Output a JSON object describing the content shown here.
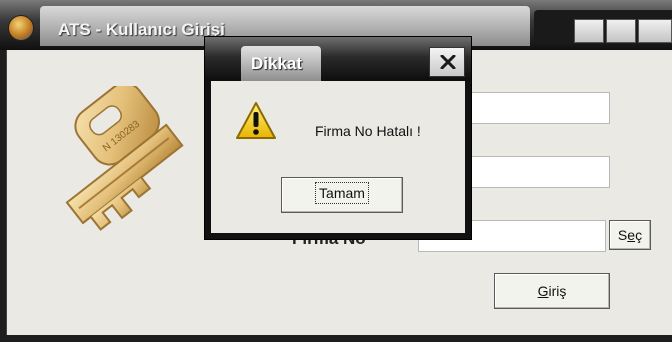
{
  "main_window": {
    "title": "ATS - Kullanıcı Girişi",
    "fields": {
      "firma_no_label": "Firma No",
      "username_value": "",
      "password_value": "",
      "firma_no_value": ""
    },
    "buttons": {
      "sec": {
        "prefix": "S",
        "accel": "e",
        "suffix": "ç"
      },
      "giris": {
        "prefix": "",
        "accel": "G",
        "suffix": "iriş"
      }
    },
    "key_art_text": "N 130283"
  },
  "dialog": {
    "title": "Dikkat",
    "message": "Firma No Hatalı !",
    "ok_button": "Tamam",
    "icon": "warning-icon",
    "close_icon": "close-icon"
  },
  "colors": {
    "window_face": "#ebe9e4",
    "titlebar_dark": "#101010",
    "warning_yellow": "#f2c500"
  }
}
